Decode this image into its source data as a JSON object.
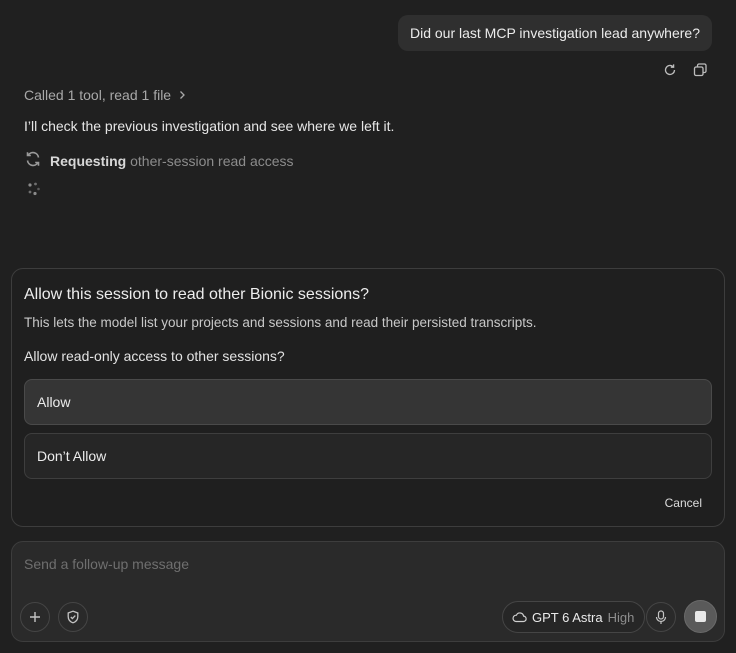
{
  "user_message": {
    "text": "Did our last MCP investigation lead anywhere?",
    "actions": [
      {
        "icon": "retry-icon"
      },
      {
        "icon": "copy-icon"
      }
    ]
  },
  "assistant": {
    "tool_summary": "Called 1 tool, read 1 file",
    "text": "I’ll check the previous investigation and see where we left it.",
    "request": {
      "status_icon": "sync-icon",
      "strong": "Requesting",
      "detail": "other-session read access"
    }
  },
  "permission_dialog": {
    "title": "Allow this session to read other Bionic sessions?",
    "description": "This lets the model list your projects and sessions and read their persisted transcripts.",
    "question": "Allow read-only access to other sessions?",
    "options": [
      {
        "label": "Allow",
        "selected": true
      },
      {
        "label": "Don’t Allow",
        "selected": false
      }
    ],
    "cancel_label": "Cancel"
  },
  "composer": {
    "placeholder": "Send a follow-up message",
    "value": "",
    "model": {
      "name": "GPT 6 Astra",
      "effort": "High",
      "icon": "cloud-icon"
    },
    "buttons": {
      "add": "plus-icon",
      "permissions": "shield-check-icon",
      "voice": "microphone-icon",
      "stop": "stop-icon"
    }
  },
  "colors": {
    "background": "#202020",
    "bubble": "#2f2f2f",
    "selected_option": "#353535",
    "stop_button": "#5a5a5a"
  }
}
